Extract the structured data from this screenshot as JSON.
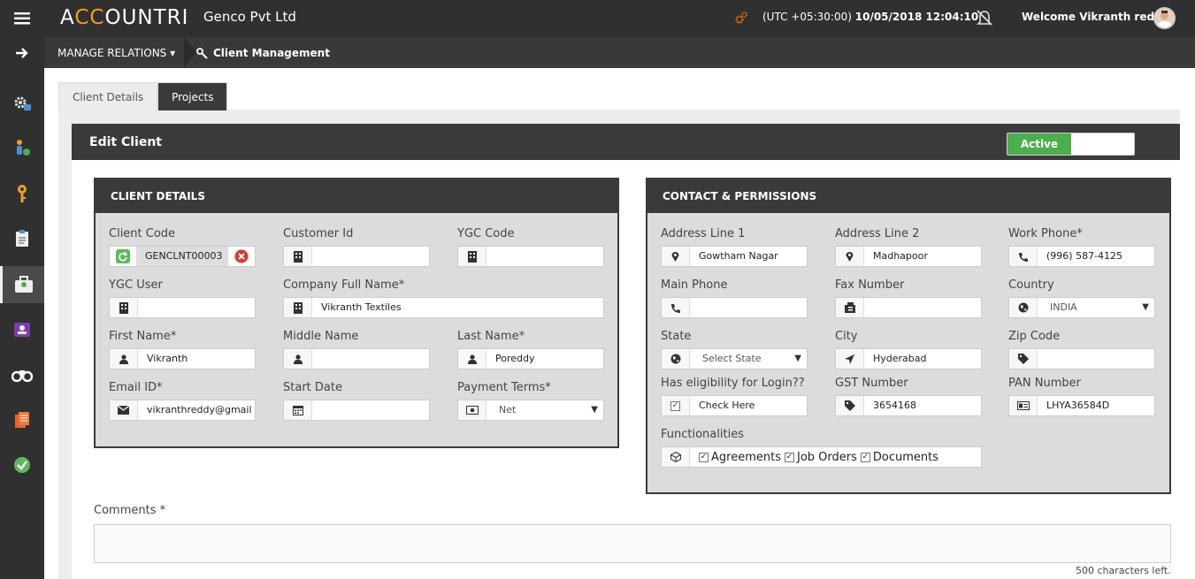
{
  "app": {
    "logo_pre": "A",
    "logo_mid": "CC",
    "logo_post": "OUNTRI",
    "company": "Genco Pvt Ltd",
    "timezone": "(UTC +05:30:00)",
    "datetime": "10/05/2018 12:04:10",
    "welcome": "Welcome Vikranth reddy"
  },
  "nav": {
    "menu_label": "MANAGE RELATIONS",
    "breadcrumb": "Client Management"
  },
  "sidebar": {
    "items": [
      {
        "icon": "settings-icon"
      },
      {
        "icon": "person-money-icon"
      },
      {
        "icon": "key-icon"
      },
      {
        "icon": "clipboard-icon"
      },
      {
        "icon": "briefcase-icon"
      },
      {
        "icon": "contact-card-icon"
      },
      {
        "icon": "binoculars-icon"
      },
      {
        "icon": "documents-icon"
      },
      {
        "icon": "check-circle-icon"
      }
    ]
  },
  "tabs": [
    "Client Details",
    "Projects"
  ],
  "edit": {
    "title": "Edit Client",
    "status": "Active"
  },
  "client_details": {
    "header": "CLIENT DETAILS",
    "client_code_label": "Client Code",
    "client_code": "GENCLNT00003",
    "customer_id_label": "Customer Id",
    "customer_id": "",
    "ygc_code_label": "YGC Code",
    "ygc_code": "",
    "ygc_user_label": "YGC User",
    "ygc_user": "",
    "company_full_name_label": "Company Full Name*",
    "company_full_name": "Vikranth Textiles",
    "first_name_label": "First Name*",
    "first_name": "Vikranth",
    "middle_name_label": "Middle Name",
    "middle_name": "",
    "last_name_label": "Last Name*",
    "last_name": "Poreddy",
    "email_label": "Email ID*",
    "email": "vikranthreddy@gmail",
    "start_date_label": "Start Date",
    "start_date": "",
    "payment_terms_label": "Payment Terms*",
    "payment_terms": "Net"
  },
  "contact": {
    "header": "CONTACT & PERMISSIONS",
    "address1_label": "Address Line 1",
    "address1": "Gowtham Nagar",
    "address2_label": "Address Line 2",
    "address2": "Madhapoor",
    "work_phone_label": "Work Phone*",
    "work_phone": "(996) 587-4125",
    "main_phone_label": "Main Phone",
    "main_phone": "",
    "fax_label": "Fax Number",
    "fax": "",
    "country_label": "Country",
    "country": "INDIA",
    "state_label": "State",
    "state": "Select State",
    "city_label": "City",
    "city": "Hyderabad",
    "zip_label": "Zip Code",
    "zip": "",
    "login_label": "Has eligibility for Login??",
    "login_value": "Check Here",
    "gst_label": "GST Number",
    "gst": "3654168",
    "pan_label": "PAN Number",
    "pan": "LHYA36584D",
    "functionalities_label": "Functionalities",
    "functionalities": [
      "Agreements",
      "Job Orders",
      "Documents"
    ]
  },
  "comments": {
    "label": "Comments *",
    "value": "",
    "chars_left": "500 characters left."
  }
}
